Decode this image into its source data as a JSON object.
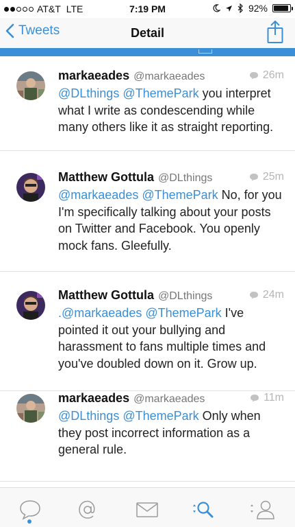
{
  "status_bar": {
    "carrier": "AT&T",
    "network": "LTE",
    "time": "7:19 PM",
    "battery": "92%",
    "battery_level": 0.92
  },
  "nav": {
    "back_label": "Tweets",
    "title": "Detail"
  },
  "tweets": [
    {
      "author": "markaeades",
      "handle": "@markaeades",
      "time": "26m",
      "mentions": "@DLthings @ThemePark",
      "text": " you interpret what I write as condescending while many others like it as straight reporting."
    },
    {
      "author": "Matthew Gottula",
      "handle": "@DLthings",
      "time": "25m",
      "mentions": "@markaeades @ThemePark",
      "text": " No, for you I'm specifically talking about your posts on Twitter and Facebook. You openly mock fans. Gleefully."
    },
    {
      "author": "Matthew Gottula",
      "handle": "@DLthings",
      "time": "24m",
      "mentions": ".@markaeades @ThemePark",
      "text": " I've pointed it out your bullying and harassment to fans multiple times and you've doubled down on it. Grow up."
    },
    {
      "author": "markaeades",
      "handle": "@markaeades",
      "time": "11m",
      "mentions": "@DLthings @ThemePark",
      "text": " Only when they post incorrect information as a general rule."
    }
  ],
  "tab_bar": {
    "tabs": [
      "timeline-icon",
      "mentions-icon",
      "messages-icon",
      "search-icon",
      "profile-icon"
    ],
    "active_tab": "timeline-icon"
  },
  "colors": {
    "accent": "#3b8fd6",
    "text": "#222222",
    "muted": "#777777"
  }
}
